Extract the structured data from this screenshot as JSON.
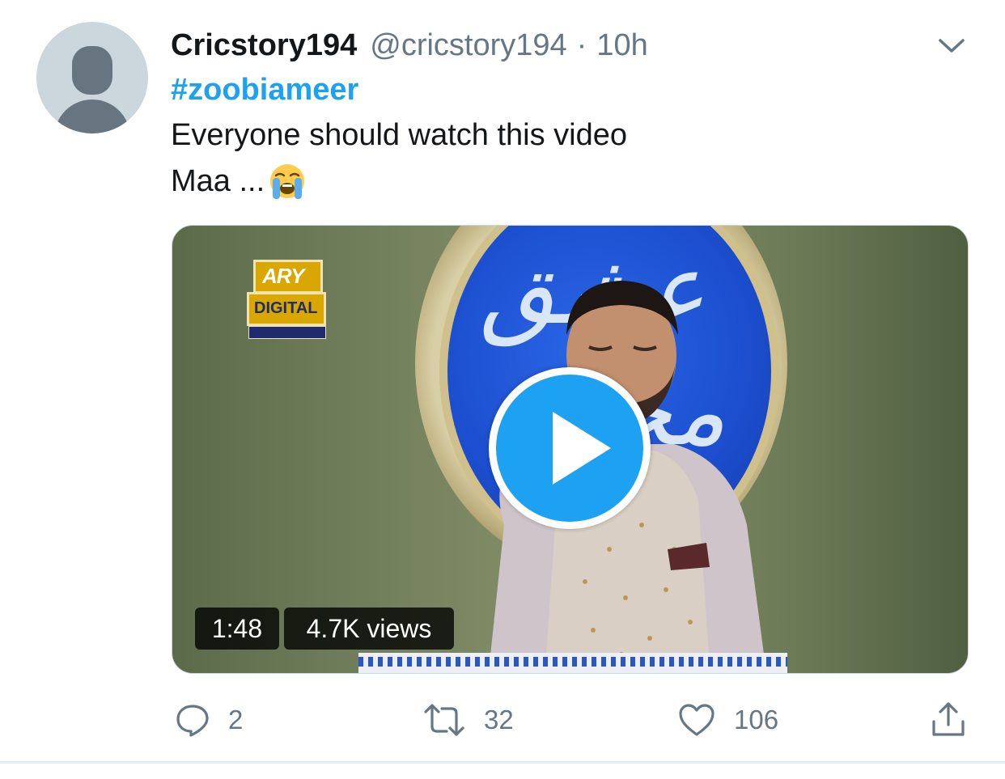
{
  "tweet": {
    "display_name": "Cricstory194",
    "handle": "@cricstory194",
    "separator": "·",
    "time": "10h",
    "hashtag": "#zoobiameer",
    "text_line1": "Everyone should watch this video",
    "text_line2": "Maa ...",
    "emoji": "loudly-crying-face-emoji"
  },
  "media": {
    "channel_logo_line1": "ARY",
    "channel_logo_line2": "DIGITAL",
    "duration": "1:48",
    "views": "4.7K views",
    "play_icon": "play-icon"
  },
  "actions": {
    "replies": "2",
    "retweets": "32",
    "likes": "106"
  },
  "colors": {
    "accent": "#1da1f2",
    "text": "#14171a",
    "muted": "#657786"
  }
}
